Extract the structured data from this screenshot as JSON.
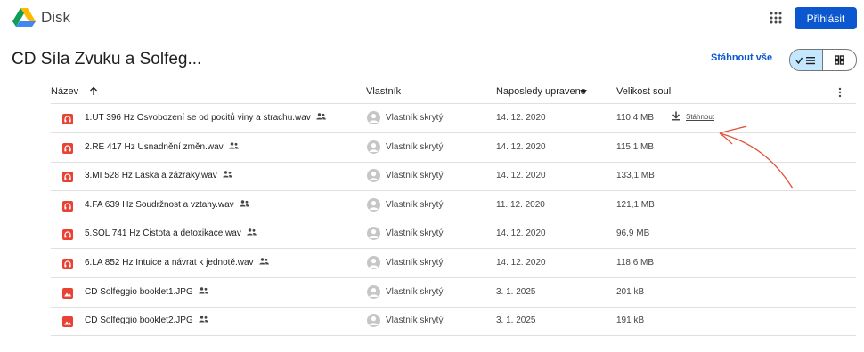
{
  "app": {
    "name": "Disk",
    "signin_label": "Přihlásit"
  },
  "folder": {
    "title": "CD Síla Zvuku a Solfeg...",
    "download_all": "Stáhnout vše"
  },
  "columns": {
    "name": "Název",
    "owner": "Vlastník",
    "modified": "Naposledy upraveno",
    "size": "Velikost soul"
  },
  "download_label": "Stáhnout",
  "files": [
    {
      "name": "1.UT 396 Hz Osvobození se od pocitů viny a strachu.wav",
      "owner": "Vlastník skrytý",
      "date": "14. 12. 2020",
      "size": "110,4 MB",
      "type": "audio"
    },
    {
      "name": "2.RE 417 Hz Usnadnění změn.wav",
      "owner": "Vlastník skrytý",
      "date": "14. 12. 2020",
      "size": "115,1 MB",
      "type": "audio"
    },
    {
      "name": "3.MI 528 Hz Láska a zázraky.wav",
      "owner": "Vlastník skrytý",
      "date": "14. 12. 2020",
      "size": "133,1 MB",
      "type": "audio"
    },
    {
      "name": "4.FA 639 Hz Soudržnost a vztahy.wav",
      "owner": "Vlastník skrytý",
      "date": "11. 12. 2020",
      "size": "121,1 MB",
      "type": "audio"
    },
    {
      "name": "5.SOL 741 Hz Čistota a detoxikace.wav",
      "owner": "Vlastník skrytý",
      "date": "14. 12. 2020",
      "size": "96,9 MB",
      "type": "audio"
    },
    {
      "name": "6.LA 852 Hz Intuice a návrat k jednotě.wav",
      "owner": "Vlastník skrytý",
      "date": "14. 12. 2020",
      "size": "118,6 MB",
      "type": "audio"
    },
    {
      "name": "CD Solfeggio booklet1.JPG",
      "owner": "Vlastník skrytý",
      "date": "3. 1. 2025",
      "size": "201 kB",
      "type": "image"
    },
    {
      "name": "CD Solfeggio booklet2.JPG",
      "owner": "Vlastník skrytý",
      "date": "3. 1. 2025",
      "size": "191 kB",
      "type": "image"
    }
  ],
  "colors": {
    "accent": "#0b57d0",
    "audio_icon": "#e94235",
    "image_icon": "#e94235",
    "annotation_arrow": "#e0523a"
  }
}
